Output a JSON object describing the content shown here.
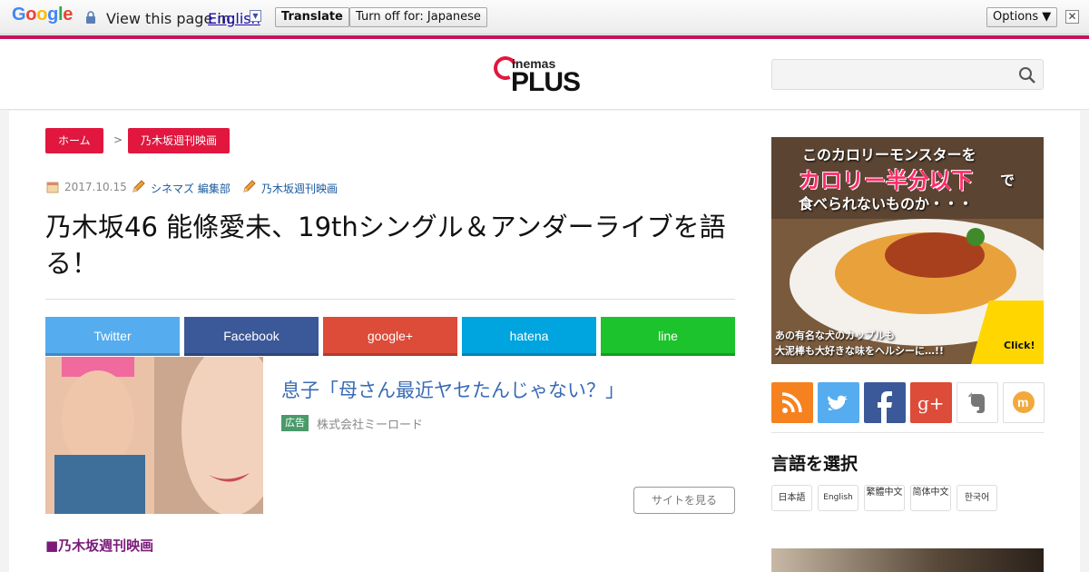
{
  "translate_bar": {
    "logo": "Google",
    "view_text": "View this page in:",
    "language": "English",
    "translate_label": "Translate",
    "turn_off_label": "Turn off for: Japanese",
    "options_label": "Options ▼",
    "close_label": "✕"
  },
  "site": {
    "logo_top": "inemas",
    "logo_bottom": "PLUS",
    "search_placeholder": ""
  },
  "breadcrumb": {
    "home": "ホーム",
    "separator": ">",
    "category": "乃木坂週刊映画"
  },
  "meta": {
    "date": "2017.10.15",
    "author": "シネマズ 編集部",
    "category": "乃木坂週刊映画"
  },
  "article": {
    "title": "乃木坂46 能條愛未、19thシングル＆アンダーライブを語る！",
    "section_heading": "■乃木坂週刊映画"
  },
  "share": {
    "twitter": "Twitter",
    "facebook": "Facebook",
    "google": "google+",
    "hatena": "hatena",
    "line": "line"
  },
  "ad": {
    "title": "息子「母さん最近ヤセたんじゃない？」",
    "badge": "広告",
    "sponsor": "株式会社ミーロード",
    "cta": "サイトを見る"
  },
  "sidebar_ad": {
    "line1": "このカロリーモンスターを",
    "line2": "カロリー半分以下",
    "line2_suffix": "で",
    "line3": "食べられないものか・・・",
    "line4": "あの有名な犬のカップルも",
    "line5": "大泥棒も大好きな味をヘルシーに…!!",
    "click": "Click!"
  },
  "language_selector": {
    "heading": "言語を選択",
    "options": [
      "日本語",
      "English",
      "繁體中文",
      "简体中文",
      "한국어"
    ]
  },
  "colors": {
    "brand": "#e1173f",
    "header_stripe": "#c4145a",
    "twitter": "#55acee",
    "facebook": "#3b5998",
    "google": "#dd4b39",
    "hatena": "#00a4de",
    "line": "#1dc32c"
  }
}
